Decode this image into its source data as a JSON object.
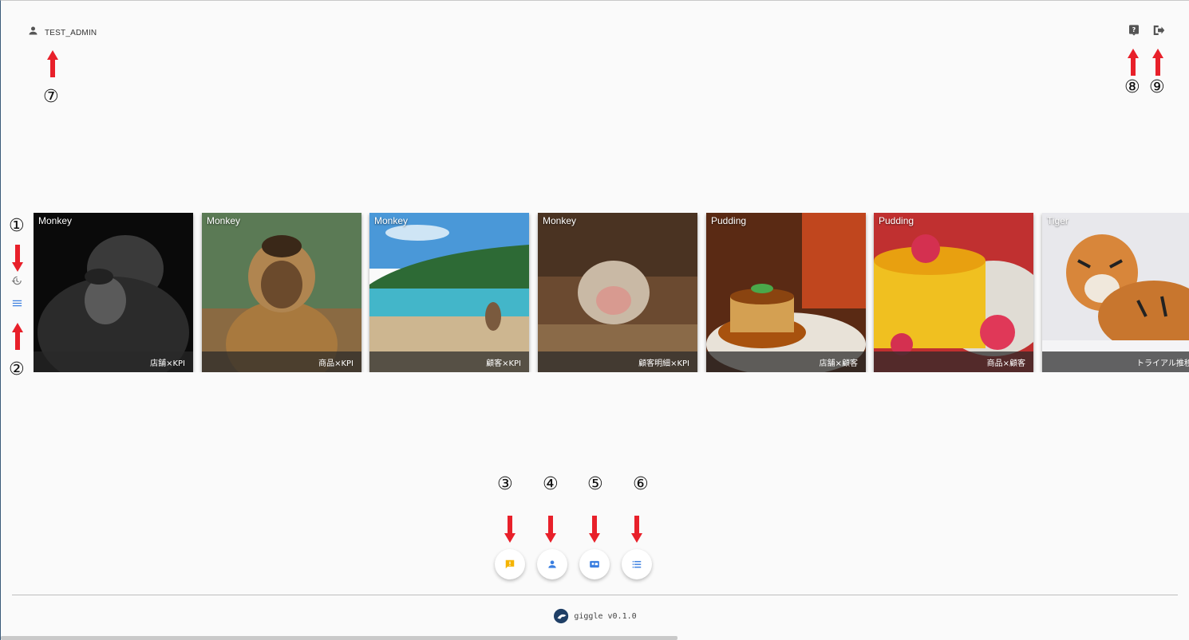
{
  "header": {
    "username": "TEST_ADMIN",
    "user_icon": "person-icon",
    "help_icon": "help-icon",
    "logout_icon": "logout-icon"
  },
  "annotations": [
    "①",
    "②",
    "③",
    "④",
    "⑤",
    "⑥",
    "⑦",
    "⑧",
    "⑨"
  ],
  "sidebar": {
    "history_icon": "history-icon",
    "menu_icon": "menu-icon"
  },
  "cards": [
    {
      "title": "Monkey",
      "caption": "店舗×KPI"
    },
    {
      "title": "Monkey",
      "caption": "商品×KPI"
    },
    {
      "title": "Monkey",
      "caption": "顧客×KPI"
    },
    {
      "title": "Monkey",
      "caption": "顧客明細×KPI"
    },
    {
      "title": "Pudding",
      "caption": "店舗×顧客"
    },
    {
      "title": "Pudding",
      "caption": "商品×顧客"
    },
    {
      "title": "Tiger",
      "caption": "トライアル推移"
    }
  ],
  "fabs": [
    {
      "icon": "feedback-icon",
      "color": "#f5b400"
    },
    {
      "icon": "person-icon",
      "color": "#3b7fe0"
    },
    {
      "icon": "contact-card-icon",
      "color": "#3b7fe0"
    },
    {
      "icon": "list-icon",
      "color": "#3b7fe0"
    }
  ],
  "footer": {
    "version": "giggle v0.1.0"
  },
  "colors": {
    "accent": "#3b7fe0",
    "arrow": "#e8202a",
    "background": "#fafafa"
  }
}
